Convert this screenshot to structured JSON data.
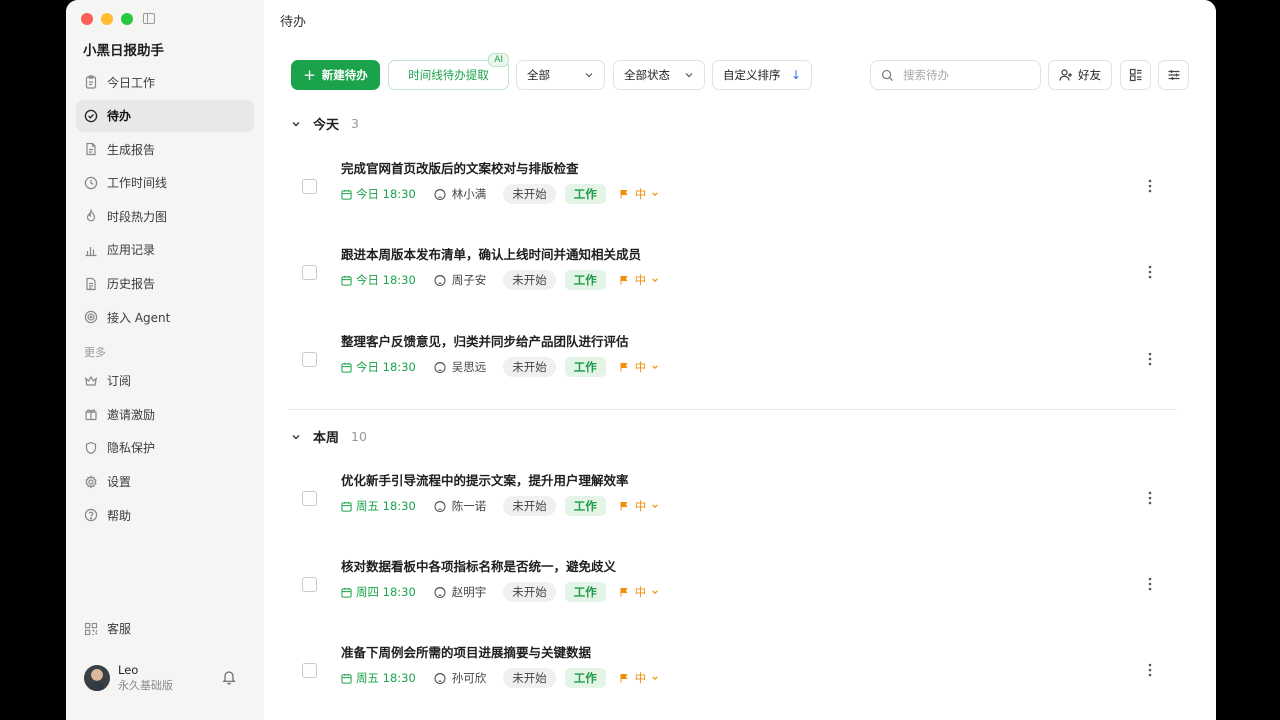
{
  "app": {
    "title": "小黑日报助手"
  },
  "sidebar": {
    "items": [
      {
        "label": "今日工作",
        "icon": "clipboard-icon"
      },
      {
        "label": "待办",
        "icon": "check-circle-icon",
        "active": true
      },
      {
        "label": "生成报告",
        "icon": "document-icon"
      },
      {
        "label": "工作时间线",
        "icon": "clock-icon"
      },
      {
        "label": "时段热力图",
        "icon": "flame-icon"
      },
      {
        "label": "应用记录",
        "icon": "bar-chart-icon"
      },
      {
        "label": "历史报告",
        "icon": "history-doc-icon"
      },
      {
        "label": "接入 Agent",
        "icon": "agent-icon"
      }
    ],
    "more_label": "更多",
    "more_items": [
      {
        "label": "订阅",
        "icon": "crown-icon"
      },
      {
        "label": "邀请激励",
        "icon": "gift-icon"
      },
      {
        "label": "隐私保护",
        "icon": "shield-icon"
      },
      {
        "label": "设置",
        "icon": "gear-icon"
      },
      {
        "label": "帮助",
        "icon": "help-icon"
      }
    ],
    "service_label": "客服",
    "user": {
      "name": "Leo",
      "plan": "永久基础版"
    }
  },
  "main": {
    "page_title": "待办",
    "toolbar": {
      "new_label": "新建待办",
      "timeline_label": "时间线待办提取",
      "ai_badge": "AI",
      "filter_all": "全部",
      "filter_status": "全部状态",
      "sort_label": "自定义排序",
      "search_placeholder": "搜索待办",
      "friend_label": "好友"
    },
    "groups": [
      {
        "title": "今天",
        "count": "3",
        "tasks": [
          {
            "title": "完成官网首页改版后的文案校对与排版检查",
            "date": "今日 18:30",
            "assignee": "林小满",
            "status": "未开始",
            "tag": "工作",
            "priority": "中"
          },
          {
            "title": "跟进本周版本发布清单，确认上线时间并通知相关成员",
            "date": "今日 18:30",
            "assignee": "周子安",
            "status": "未开始",
            "tag": "工作",
            "priority": "中"
          },
          {
            "title": "整理客户反馈意见，归类并同步给产品团队进行评估",
            "date": "今日 18:30",
            "assignee": "吴思远",
            "status": "未开始",
            "tag": "工作",
            "priority": "中"
          }
        ]
      },
      {
        "title": "本周",
        "count": "10",
        "tasks": [
          {
            "title": "优化新手引导流程中的提示文案，提升用户理解效率",
            "date": "周五 18:30",
            "assignee": "陈一诺",
            "status": "未开始",
            "tag": "工作",
            "priority": "中"
          },
          {
            "title": "核对数据看板中各项指标名称是否统一，避免歧义",
            "date": "周四 18:30",
            "assignee": "赵明宇",
            "status": "未开始",
            "tag": "工作",
            "priority": "中"
          },
          {
            "title": "准备下周例会所需的项目进展摘要与关键数据",
            "date": "周五 18:30",
            "assignee": "孙可欣",
            "status": "未开始",
            "tag": "工作",
            "priority": "中"
          }
        ]
      }
    ]
  },
  "colors": {
    "accent": "#1aa34a",
    "priority": "#f0900a",
    "sidebar_bg": "#f5f5f4"
  }
}
